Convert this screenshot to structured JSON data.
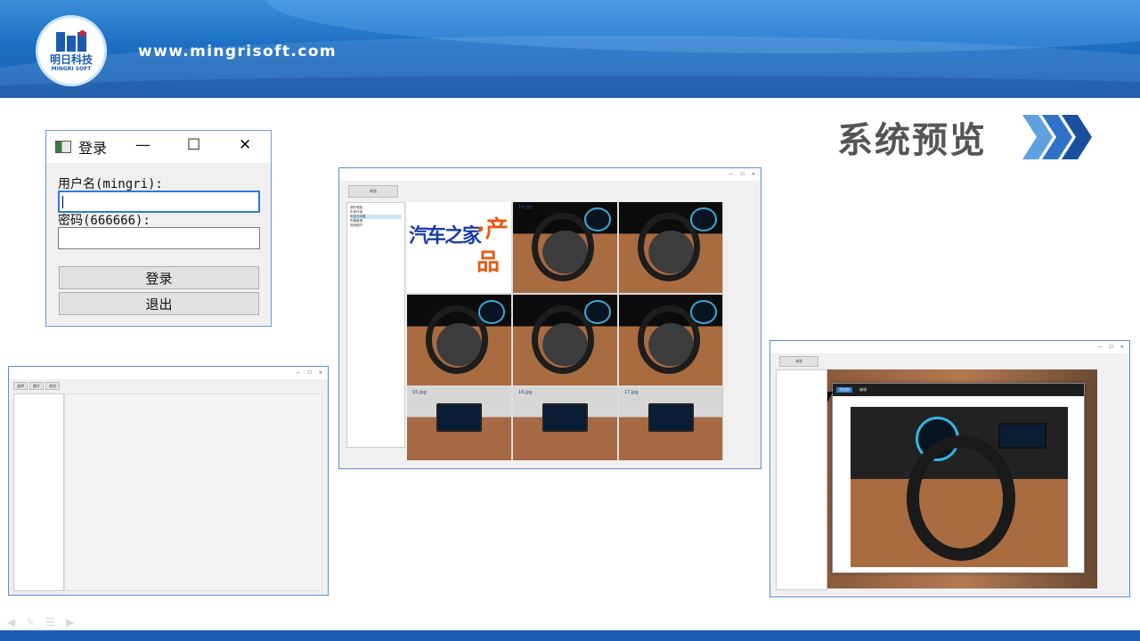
{
  "header": {
    "logo_name": "明日科技",
    "logo_sub": "MINGRI SOFT",
    "site_url": "www.mingrisoft.com"
  },
  "section_title": "系统预览",
  "login_window": {
    "title": "登录",
    "minimize_glyph": "—",
    "maximize_glyph": "☐",
    "close_glyph": "✕",
    "username_label": "用户名(mingri):",
    "username_value": "",
    "password_label": "密码(666666):",
    "password_value": "",
    "login_button": "登录",
    "exit_button": "退出"
  },
  "empty_window": {
    "toolbar_buttons": [
      "选择",
      "图片",
      "浏览"
    ]
  },
  "browse_window": {
    "toolbar_button": "浏览",
    "tree_items": [
      "我的电脑",
      "车身外观",
      "中控方向盘",
      "车厢座椅",
      "其他细节"
    ],
    "thumbnails": [
      {
        "caption": "",
        "kind": "ad"
      },
      {
        "caption": "10.jpg",
        "kind": "dash"
      },
      {
        "caption": "",
        "kind": "dash"
      },
      {
        "caption": "",
        "kind": "dash"
      },
      {
        "caption": "",
        "kind": "dash"
      },
      {
        "caption": "",
        "kind": "dash"
      },
      {
        "caption": "15.jpg",
        "kind": "console"
      },
      {
        "caption": "16.jpg",
        "kind": "console"
      },
      {
        "caption": "17.jpg",
        "kind": "console"
      }
    ],
    "ad_text_blue": "汽车之家",
    "ad_text_orange": "·产品"
  },
  "viewer_window": {
    "toolbar_button": "浏览",
    "viewer_actions": [
      "添加到",
      "编辑"
    ]
  },
  "colors": {
    "banner": "#1d6fc4",
    "accent_blue": "#2f7ad8",
    "title_gray": "#555555"
  }
}
